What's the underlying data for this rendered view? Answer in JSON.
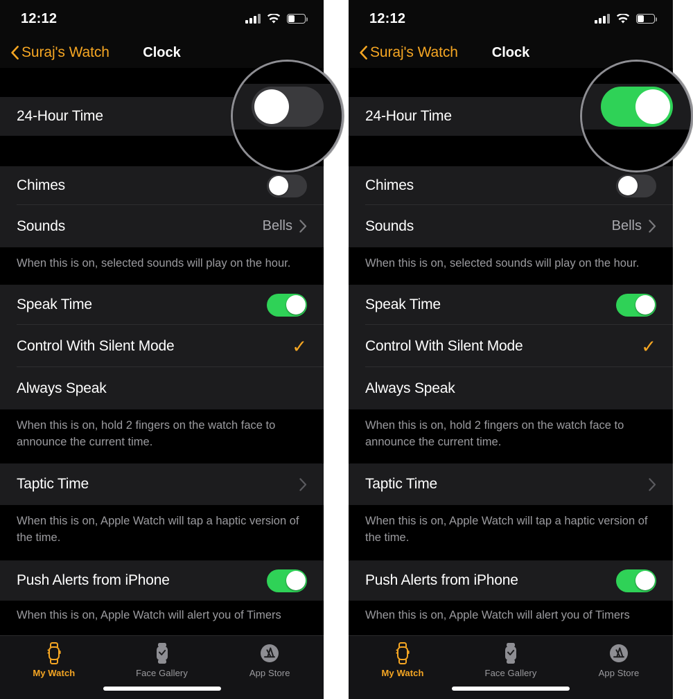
{
  "panels": [
    {
      "id": "left",
      "toggle_24h_state": "off"
    },
    {
      "id": "right",
      "toggle_24h_state": "on"
    }
  ],
  "status_bar": {
    "time": "12:12",
    "cellular_icon": "cellular-signal-icon",
    "wifi_icon": "wifi-icon",
    "battery_icon": "battery-icon"
  },
  "nav": {
    "back_label": "Suraj's Watch",
    "back_icon": "chevron-left-icon",
    "title": "Clock"
  },
  "rows": {
    "hour24": {
      "label": "24-Hour Time"
    },
    "chimes": {
      "label": "Chimes"
    },
    "sounds": {
      "label": "Sounds",
      "value": "Bells",
      "accessory_icon": "chevron-right-icon"
    },
    "chimes_footnote": "When this is on, selected sounds will play on the hour.",
    "speak_time": {
      "label": "Speak Time"
    },
    "control_silent": {
      "label": "Control With Silent Mode",
      "accessory_icon": "checkmark-icon"
    },
    "always_speak": {
      "label": "Always Speak"
    },
    "speak_footnote": "When this is on, hold 2 fingers on the watch face to announce the current time.",
    "taptic": {
      "label": "Taptic Time",
      "accessory_icon": "chevron-right-icon"
    },
    "taptic_footnote": "When this is on, Apple Watch will tap a haptic version of the time.",
    "push_alerts": {
      "label": "Push Alerts from iPhone"
    },
    "push_footnote": "When this is on, Apple Watch will alert you of Timers"
  },
  "toggle_states": {
    "chimes": "off",
    "speak_time": "on",
    "push_alerts": "on"
  },
  "tabbar": {
    "tabs": [
      {
        "label": "My Watch",
        "icon": "apple-watch-icon",
        "active": true
      },
      {
        "label": "Face Gallery",
        "icon": "watch-face-icon",
        "active": false
      },
      {
        "label": "App Store",
        "icon": "app-store-icon",
        "active": false
      }
    ],
    "home_indicator": "home-indicator"
  },
  "colors": {
    "accent_orange": "#f5a623",
    "toggle_on_green": "#2fd257",
    "toggle_off_gray": "#39393c",
    "row_background": "#1c1c1e",
    "page_background": "#000000"
  },
  "magnifier": {
    "ring_color": "#8e8e93",
    "left_shows": "24-hour-time-toggle-off",
    "right_shows": "24-hour-time-toggle-on"
  }
}
